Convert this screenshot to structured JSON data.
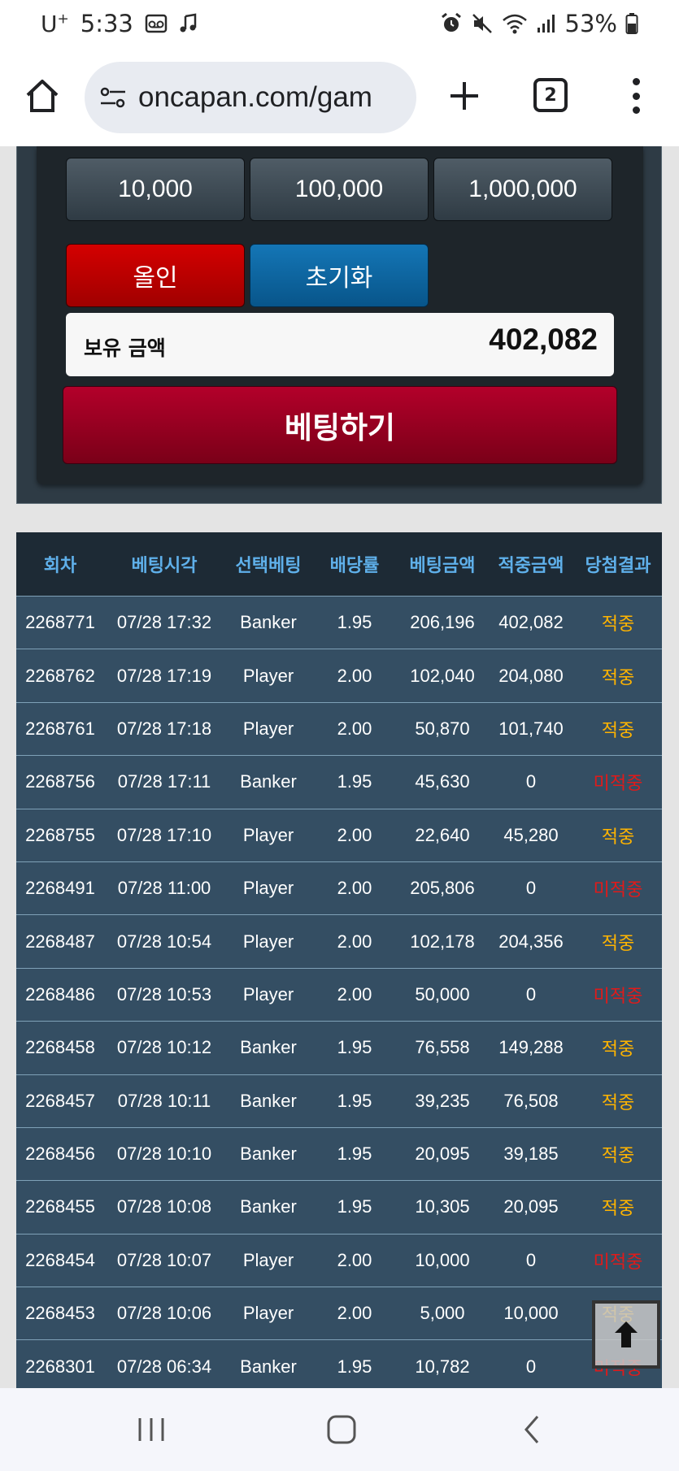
{
  "status_bar": {
    "carrier": "U",
    "carrier_sup": "+",
    "time": "5:33",
    "battery": "53%"
  },
  "browser": {
    "url": "oncapan.com/gam",
    "tab_count": "2"
  },
  "bet_panel": {
    "chips": [
      "10,000",
      "100,000",
      "1,000,000"
    ],
    "allin_label": "올인",
    "reset_label": "초기화",
    "balance_label": "보유 금액",
    "balance_value": "402,082",
    "submit_label": "베팅하기"
  },
  "history": {
    "headers": [
      "회차",
      "베팅시각",
      "선택베팅",
      "배당률",
      "베팅금액",
      "적중금액",
      "당첨결과"
    ],
    "rows": [
      [
        "2268771",
        "07/28 17:32",
        "Banker",
        "1.95",
        "206,196",
        "402,082",
        "적중"
      ],
      [
        "2268762",
        "07/28 17:19",
        "Player",
        "2.00",
        "102,040",
        "204,080",
        "적중"
      ],
      [
        "2268761",
        "07/28 17:18",
        "Player",
        "2.00",
        "50,870",
        "101,740",
        "적중"
      ],
      [
        "2268756",
        "07/28 17:11",
        "Banker",
        "1.95",
        "45,630",
        "0",
        "미적중"
      ],
      [
        "2268755",
        "07/28 17:10",
        "Player",
        "2.00",
        "22,640",
        "45,280",
        "적중"
      ],
      [
        "2268491",
        "07/28 11:00",
        "Player",
        "2.00",
        "205,806",
        "0",
        "미적중"
      ],
      [
        "2268487",
        "07/28 10:54",
        "Player",
        "2.00",
        "102,178",
        "204,356",
        "적중"
      ],
      [
        "2268486",
        "07/28 10:53",
        "Player",
        "2.00",
        "50,000",
        "0",
        "미적중"
      ],
      [
        "2268458",
        "07/28 10:12",
        "Banker",
        "1.95",
        "76,558",
        "149,288",
        "적중"
      ],
      [
        "2268457",
        "07/28 10:11",
        "Banker",
        "1.95",
        "39,235",
        "76,508",
        "적중"
      ],
      [
        "2268456",
        "07/28 10:10",
        "Banker",
        "1.95",
        "20,095",
        "39,185",
        "적중"
      ],
      [
        "2268455",
        "07/28 10:08",
        "Banker",
        "1.95",
        "10,305",
        "20,095",
        "적중"
      ],
      [
        "2268454",
        "07/28 10:07",
        "Player",
        "2.00",
        "10,000",
        "0",
        "미적중"
      ],
      [
        "2268453",
        "07/28 10:06",
        "Player",
        "2.00",
        "5,000",
        "10,000",
        "적중"
      ],
      [
        "2268301",
        "07/28 06:34",
        "Banker",
        "1.95",
        "10,782",
        "0",
        "미적중"
      ]
    ]
  },
  "colors": {
    "win": "#ffb400",
    "lose": "#e11a1a",
    "header_text": "#5fb0ea",
    "row_bg": "#344e63"
  },
  "icons": {
    "alarm": "alarm-icon",
    "mute": "mute-icon",
    "wifi": "wifi-icon",
    "signal": "signal-icon",
    "battery": "battery-icon",
    "home": "home-icon",
    "site_settings": "site-settings-icon",
    "new_tab": "plus-icon",
    "menu": "more-vert-icon",
    "scroll_top": "arrow-up-icon",
    "recents": "recents-icon",
    "nav_home": "nav-home-icon",
    "back": "back-icon"
  }
}
